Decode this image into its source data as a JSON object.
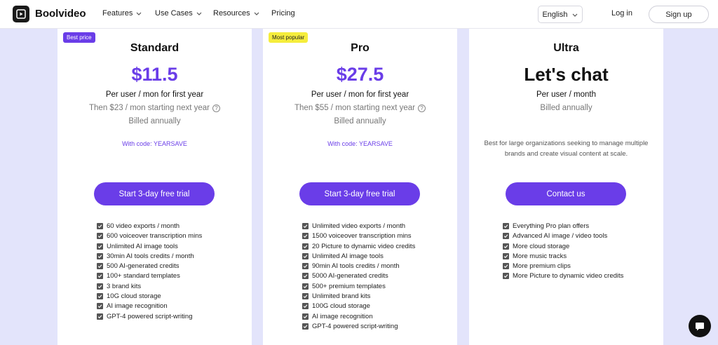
{
  "header": {
    "brand": "Boolvideo",
    "nav": [
      {
        "label": "Features",
        "has_dropdown": true
      },
      {
        "label": "Use Cases",
        "has_dropdown": true
      },
      {
        "label": "Resources",
        "has_dropdown": true
      },
      {
        "label": "Pricing",
        "has_dropdown": false
      }
    ],
    "language": "English",
    "login": "Log in",
    "signup": "Sign up"
  },
  "plans": [
    {
      "badge": "Best price",
      "name": "Standard",
      "price": "$11.5",
      "billing_line": "Per user / mon for first year",
      "renewal_line": "Then $23 / mon starting next year",
      "billed": "Billed annually",
      "code_line": "With code: YEARSAVE",
      "cta": "Start 3-day free trial",
      "features": [
        "60 video exports / month",
        "600 voiceover transcription mins",
        "Unlimited AI image tools",
        "30min AI tools credits / month",
        "500 AI-generated credits",
        "100+ standard templates",
        "3 brand kits",
        "10G cloud storage",
        "AI image recognition",
        "GPT-4 powered script-writing"
      ]
    },
    {
      "badge": "Most popular",
      "name": "Pro",
      "price": "$27.5",
      "billing_line": "Per user / mon for first year",
      "renewal_line": "Then $55 / mon starting next year",
      "billed": "Billed annually",
      "code_line": "With code: YEARSAVE",
      "cta": "Start 3-day free trial",
      "features": [
        "Unlimited video exports / month",
        "1500 voiceover transcription mins",
        "20 Picture to dynamic video credits",
        "Unlimited AI image tools",
        "90min AI tools credits / month",
        "5000 AI-generated credits",
        "500+ premium templates",
        "Unlimited brand kits",
        "100G cloud storage",
        "AI image recognition",
        "GPT-4 powered script-writing"
      ]
    },
    {
      "name": "Ultra",
      "price": "Let's chat",
      "billing_line": "Per user / month",
      "billed": "Billed annually",
      "description": "Best for large organizations seeking to manage multiple brands and create visual content at scale.",
      "cta": "Contact us",
      "features": [
        "Everything Pro plan offers",
        "Advanced AI image / video tools",
        "More cloud storage",
        "More music tracks",
        "More premium clips",
        "More Picture to dynamic video credits"
      ]
    }
  ],
  "colors": {
    "accent": "#6a3de8",
    "badge_popular": "#f5ed3c",
    "page_bg": "#e3e4fb"
  }
}
